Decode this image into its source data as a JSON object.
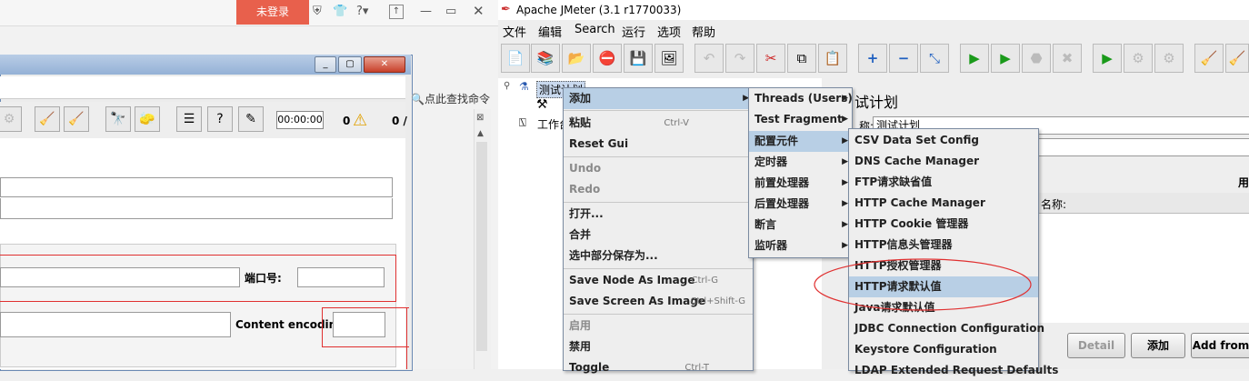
{
  "browser": {
    "login_label": "未登录",
    "search_hint": "点此查找命令",
    "icons": [
      "shield-icon",
      "shirt-icon",
      "help-icon",
      "restore-icon",
      "minimize-icon",
      "maximize-icon",
      "close-icon"
    ]
  },
  "inner_window": {
    "timer": "00:00:00",
    "warn_count": "0",
    "total": "0 /",
    "port_label": "端口号:",
    "encoding_label": "Content encoding:"
  },
  "jmeter": {
    "title": "Apache JMeter (3.1 r1770033)",
    "menus": [
      "文件",
      "编辑",
      "Search",
      "运行",
      "选项",
      "帮助"
    ],
    "tree": {
      "plan": "测试计划",
      "workbench": "工作台"
    },
    "panel_title": "试计划",
    "name_label": "称:",
    "name_value": "测试计划",
    "user_label": "用",
    "col_name": "名称:",
    "buttons": {
      "detail": "Detail",
      "add": "添加",
      "add_from": "Add from"
    }
  },
  "context_menu": {
    "items": [
      {
        "label": "添加",
        "submenu": true
      },
      {
        "label": "粘贴",
        "accel": "Ctrl-V"
      },
      {
        "label": "Reset Gui"
      },
      {
        "label": "Undo",
        "disabled": true
      },
      {
        "label": "Redo",
        "disabled": true
      },
      {
        "label": "打开..."
      },
      {
        "label": "合并"
      },
      {
        "label": "选中部分保存为..."
      },
      {
        "label": "Save Node As Image",
        "accel": "Ctrl-G"
      },
      {
        "label": "Save Screen As Image",
        "accel": "Ctrl+Shift-G"
      },
      {
        "label": "启用",
        "disabled": true
      },
      {
        "label": "禁用"
      },
      {
        "label": "Toggle",
        "accel": "Ctrl-T"
      }
    ]
  },
  "add_submenu": {
    "items": [
      "Threads (Users)",
      "Test Fragment",
      "配置元件",
      "定时器",
      "前置处理器",
      "后置处理器",
      "断言",
      "监听器"
    ]
  },
  "config_submenu": {
    "items": [
      "CSV Data Set Config",
      "DNS Cache Manager",
      "FTP请求缺省值",
      "HTTP Cache Manager",
      "HTTP Cookie 管理器",
      "HTTP信息头管理器",
      "HTTP授权管理器",
      "HTTP请求默认值",
      "Java请求默认值",
      "JDBC Connection Configuration",
      "Keystore Configuration",
      "LDAP Extended Request Defaults"
    ],
    "selected_index": 7
  },
  "colors": {
    "highlight": "#b8cfe5",
    "annotation": "#e03030",
    "login_bg": "#e8604c"
  }
}
